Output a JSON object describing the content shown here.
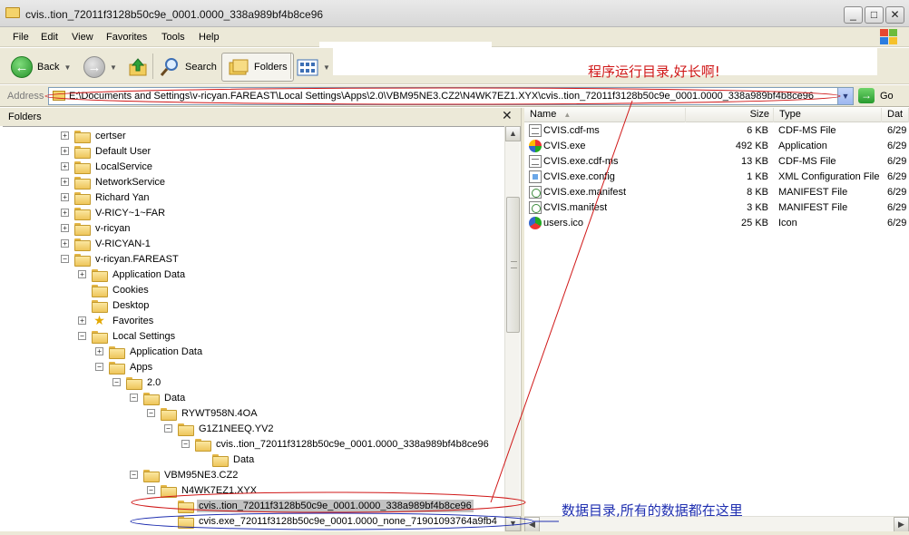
{
  "window": {
    "title": "cvis..tion_72011f3128b50c9e_0001.0000_338a989bf4b8ce96",
    "minimize_glyph": "_",
    "maximize_glyph": "□",
    "close_glyph": "✕"
  },
  "menu": {
    "file": "File",
    "edit": "Edit",
    "view": "View",
    "favorites": "Favorites",
    "tools": "Tools",
    "help": "Help"
  },
  "toolbar": {
    "back": "Back",
    "search": "Search",
    "folders": "Folders"
  },
  "address": {
    "label": "Address",
    "value": "E:\\Documents and Settings\\v-ricyan.FAREAST\\Local Settings\\Apps\\2.0\\VBM95NE3.CZ2\\N4WK7EZ1.XYX\\cvis..tion_72011f3128b50c9e_0001.0000_338a989bf4b8ce96",
    "go": "Go"
  },
  "folders_pane": {
    "header": "Folders",
    "close_glyph": "✕",
    "tree": [
      {
        "label": "certser",
        "expander": "+"
      },
      {
        "label": "Default User",
        "expander": "+"
      },
      {
        "label": "LocalService",
        "expander": "+"
      },
      {
        "label": "NetworkService",
        "expander": "+"
      },
      {
        "label": "Richard Yan",
        "expander": "+"
      },
      {
        "label": "V-RICY~1~FAR",
        "expander": "+"
      },
      {
        "label": "v-ricyan",
        "expander": "+"
      },
      {
        "label": "V-RICYAN-1",
        "expander": "+"
      },
      {
        "label": "v-ricyan.FAREAST",
        "expander": "−"
      },
      {
        "label": "Application Data",
        "expander": "+"
      },
      {
        "label": "Cookies",
        "expander": ""
      },
      {
        "label": "Desktop",
        "expander": ""
      },
      {
        "label": "Favorites",
        "expander": "+"
      },
      {
        "label": "Local Settings",
        "expander": "−"
      },
      {
        "label": "Application Data",
        "expander": "+"
      },
      {
        "label": "Apps",
        "expander": "−"
      },
      {
        "label": "2.0",
        "expander": "−"
      },
      {
        "label": "Data",
        "expander": "−"
      },
      {
        "label": "RYWT958N.4OA",
        "expander": "−"
      },
      {
        "label": "G1Z1NEEQ.YV2",
        "expander": "−"
      },
      {
        "label": "cvis..tion_72011f3128b50c9e_0001.0000_338a989bf4b8ce96",
        "expander": "−"
      },
      {
        "label": "Data",
        "expander": ""
      },
      {
        "label": "VBM95NE3.CZ2",
        "expander": "−"
      },
      {
        "label": "N4WK7EZ1.XYX",
        "expander": "−"
      },
      {
        "label": "cvis..tion_72011f3128b50c9e_0001.0000_338a989bf4b8ce96",
        "expander": ""
      },
      {
        "label": "cvis.exe_72011f3128b50c9e_0001.0000_none_71901093764a9fb4",
        "expander": ""
      }
    ]
  },
  "files_pane": {
    "columns": {
      "name": "Name",
      "size": "Size",
      "type": "Type",
      "date": "Dat"
    },
    "sort_arrow": "▲",
    "files": [
      {
        "name": "CVIS.cdf-ms",
        "size": "6 KB",
        "type": "CDF-MS File",
        "date": "6/29",
        "icon": "cdf-icon"
      },
      {
        "name": "CVIS.exe",
        "size": "492 KB",
        "type": "Application",
        "date": "6/29",
        "icon": "app-icon"
      },
      {
        "name": "CVIS.exe.cdf-ms",
        "size": "13 KB",
        "type": "CDF-MS File",
        "date": "6/29",
        "icon": "cdf-icon"
      },
      {
        "name": "CVIS.exe.config",
        "size": "1 KB",
        "type": "XML Configuration File",
        "date": "6/29",
        "icon": "xml-icon"
      },
      {
        "name": "CVIS.exe.manifest",
        "size": "8 KB",
        "type": "MANIFEST File",
        "date": "6/29",
        "icon": "manifest-icon"
      },
      {
        "name": "CVIS.manifest",
        "size": "3 KB",
        "type": "MANIFEST File",
        "date": "6/29",
        "icon": "manifest-icon"
      },
      {
        "name": "users.ico",
        "size": "25 KB",
        "type": "Icon",
        "date": "6/29",
        "icon": "ico-icon"
      }
    ]
  },
  "annotations": {
    "run_dir": "程序运行目录,好长啊!",
    "data_dir": "数据目录,所有的数据都在这里",
    "red_color": "#d01818",
    "blue_color": "#1f2fb0"
  }
}
